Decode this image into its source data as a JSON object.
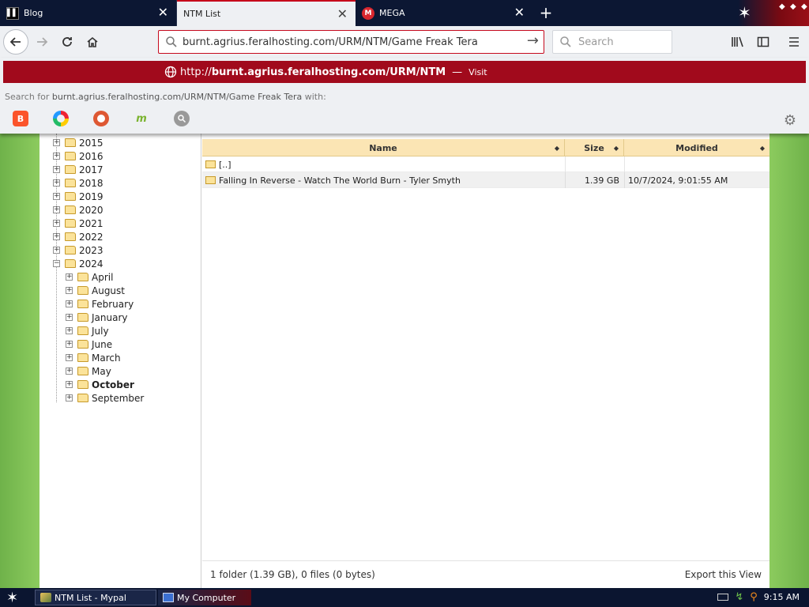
{
  "tabs": [
    {
      "title": "Blog",
      "icon": "blog-favicon",
      "active": false
    },
    {
      "title": "NTM List",
      "icon": "none",
      "active": true
    },
    {
      "title": "MEGA",
      "icon": "mega-favicon",
      "active": false
    }
  ],
  "tab_close_glyph": "✕",
  "new_tab_glyph": "+",
  "navbar": {
    "url": "burnt.agrius.feralhosting.com/URM/NTM/Game Freak Tera",
    "search_placeholder": "Search"
  },
  "autocomplete": {
    "url_prefix": "http://",
    "url_host": "burnt.agrius.feralhosting.com/URM/NTM",
    "separator": "—",
    "visit_label": "Visit",
    "search_for_prefix": "Search for",
    "search_for_text": "burnt.agrius.feralhosting.com/URM/NTM/Game Freak Tera",
    "search_for_suffix": "with:",
    "engines": [
      "brave-icon",
      "qwant-icon",
      "duckduckgo-icon",
      "mojeek-icon",
      "search-engine-icon"
    ]
  },
  "tree": {
    "years": [
      "2015",
      "2016",
      "2017",
      "2018",
      "2019",
      "2020",
      "2021",
      "2022",
      "2023",
      "2024"
    ],
    "months_2024": [
      "April",
      "August",
      "February",
      "January",
      "July",
      "June",
      "March",
      "May",
      "October",
      "September"
    ],
    "selected_month": "October"
  },
  "list": {
    "columns": {
      "name": "Name",
      "size": "Size",
      "modified": "Modified"
    },
    "parent_label": "[..]",
    "rows": [
      {
        "name": "Falling In Reverse - Watch The World Burn - Tyler Smyth",
        "size": "1.39 GB",
        "modified": "10/7/2024, 9:01:55 AM"
      }
    ],
    "status": "1 folder (1.39 GB), 0 files (0 bytes)",
    "export_label": "Export this View"
  },
  "taskbar": {
    "tasks": [
      "NTM List - Mypal",
      "My Computer"
    ],
    "clock": "9:15 AM"
  },
  "colors": {
    "accent": "#a10a1c",
    "tabbar": "#0c1733",
    "header": "#fbe5b4",
    "folder": "#fbe39a"
  }
}
